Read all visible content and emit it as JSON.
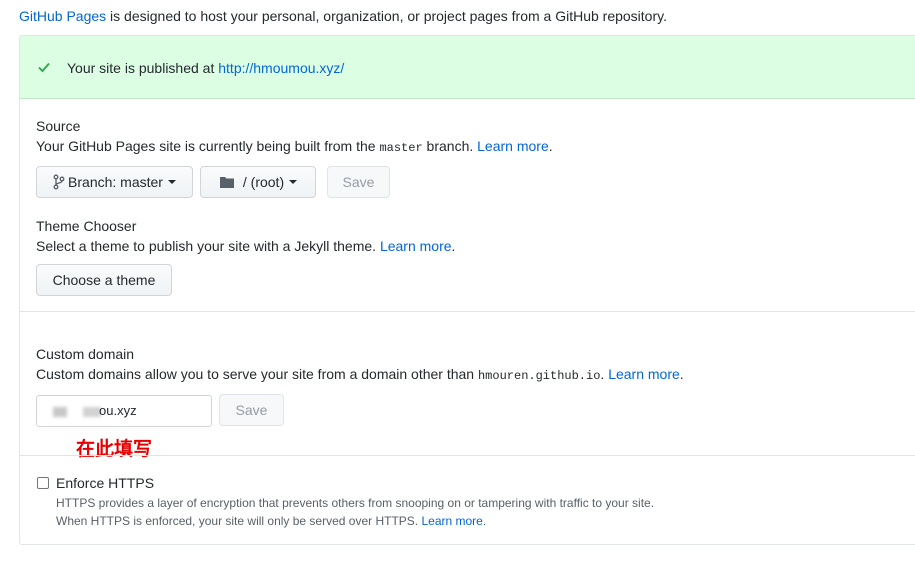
{
  "intro": {
    "link": "GitHub Pages",
    "text": " is designed to host your personal, organization, or project pages from a GitHub repository."
  },
  "flash": {
    "icon": "check-icon",
    "text": "Your site is published at ",
    "url": "http://hmoumou.xyz/",
    "color": "#dcffe4"
  },
  "source": {
    "title": "Source",
    "desc_pre": "Your GitHub Pages site is currently being built from the ",
    "branch_code": "master",
    "desc_post": " branch. ",
    "learn_more": "Learn more",
    "period": ".",
    "branch_button": "Branch: master",
    "folder_button": "/ (root)",
    "save": "Save"
  },
  "theme": {
    "title": "Theme Chooser",
    "desc": "Select a theme to publish your site with a Jekyll theme. ",
    "learn_more": "Learn more",
    "period": ".",
    "button": "Choose a theme"
  },
  "custom_domain": {
    "title": "Custom domain",
    "desc": "Custom domains allow you to serve your site from a domain other than ",
    "code": "hmouren.github.io",
    "period_space": ". ",
    "learn_more": "Learn more",
    "period": ".",
    "value": "ou.xyz",
    "save": "Save",
    "annotation": "在此填写"
  },
  "https": {
    "title": "Enforce HTTPS",
    "line1": "HTTPS provides a layer of encryption that prevents others from snooping on or tampering with traffic to your site.",
    "line2": "When HTTPS is enforced, your site will only be served over HTTPS. ",
    "learn_more": "Learn more",
    "period": "."
  }
}
